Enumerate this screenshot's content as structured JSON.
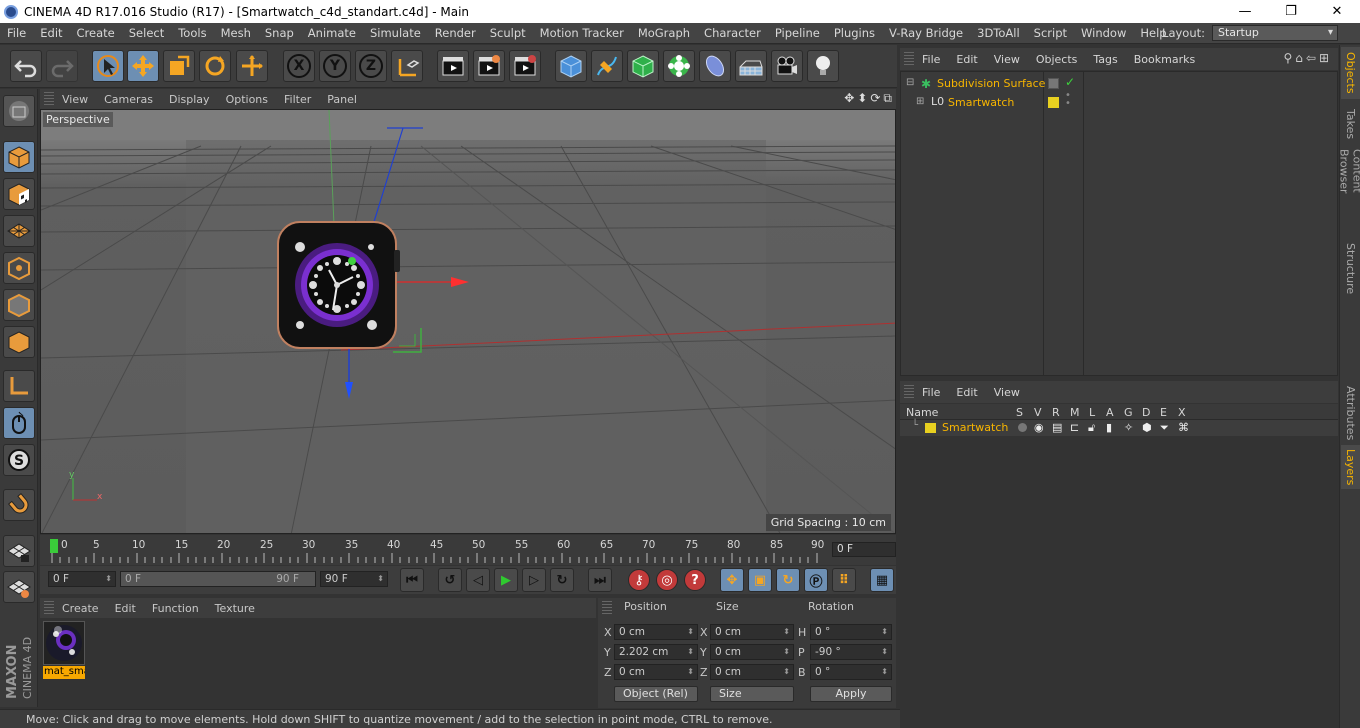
{
  "window": {
    "title": "CINEMA 4D R17.016 Studio (R17) - [Smartwatch_c4d_standart.c4d] - Main",
    "min": "—",
    "max": "❐",
    "close": "✕"
  },
  "menubar": {
    "items": [
      "File",
      "Edit",
      "Create",
      "Select",
      "Tools",
      "Mesh",
      "Snap",
      "Animate",
      "Simulate",
      "Render",
      "Sculpt",
      "Motion Tracker",
      "MoGraph",
      "Character",
      "Pipeline",
      "Plugins",
      "V-Ray Bridge",
      "3DToAll",
      "Script",
      "Window",
      "Help"
    ],
    "layout_label": "Layout:",
    "layout_value": "Startup"
  },
  "toolbar": {
    "axis_x": "X",
    "axis_y": "Y",
    "axis_z": "Z"
  },
  "viewport": {
    "menu": [
      "View",
      "Cameras",
      "Display",
      "Options",
      "Filter",
      "Panel"
    ],
    "label": "Perspective",
    "grid_spacing": "Grid Spacing : 10 cm",
    "axis_x": "x",
    "axis_y": "y"
  },
  "timeline": {
    "ticks": [
      "0",
      "5",
      "10",
      "15",
      "20",
      "25",
      "30",
      "35",
      "40",
      "45",
      "50",
      "55",
      "60",
      "65",
      "70",
      "75",
      "80",
      "85",
      "90"
    ],
    "current_frame": "0 F"
  },
  "transport": {
    "start": "0 F",
    "range_start": "0 F",
    "range_end": "90 F",
    "end": "90 F"
  },
  "material_manager": {
    "menu": [
      "Create",
      "Edit",
      "Function",
      "Texture"
    ],
    "material_name": "mat_smartwatch"
  },
  "coordinates": {
    "headers": [
      "Position",
      "Size",
      "Rotation"
    ],
    "position": {
      "x": "0 cm",
      "y": "2.202 cm",
      "z": "0 cm"
    },
    "size": {
      "x": "0 cm",
      "y": "0 cm",
      "z": "0 cm"
    },
    "rotation": {
      "h": "0 °",
      "p": "-90 °",
      "b": "0 °"
    },
    "axis_labels": {
      "x": "X",
      "y": "Y",
      "z": "Z",
      "h": "H",
      "p": "P",
      "b": "B"
    },
    "mode": "Object (Rel)",
    "size_mode": "Size",
    "apply": "Apply"
  },
  "object_manager": {
    "menu": [
      "File",
      "Edit",
      "View",
      "Objects",
      "Tags",
      "Bookmarks"
    ],
    "objects": [
      {
        "name": "Subdivision Surface"
      },
      {
        "name": "Smartwatch"
      }
    ]
  },
  "layer_manager": {
    "menu": [
      "File",
      "Edit",
      "View"
    ],
    "columns": [
      "Name",
      "S",
      "V",
      "R",
      "M",
      "L",
      "A",
      "G",
      "D",
      "E",
      "X"
    ],
    "layers": [
      {
        "name": "Smartwatch",
        "color": "#e8d020"
      }
    ]
  },
  "right_tabs": {
    "top": [
      "Objects",
      "Takes",
      "Content Browser",
      "Structure"
    ],
    "bottom": [
      "Attributes",
      "Layers"
    ]
  },
  "status": "Move: Click and drag to move elements. Hold down SHIFT to quantize movement / add to the selection in point mode, CTRL to remove.",
  "colors": {
    "accent": "#6d8fb3",
    "selection": "#f7b500"
  }
}
